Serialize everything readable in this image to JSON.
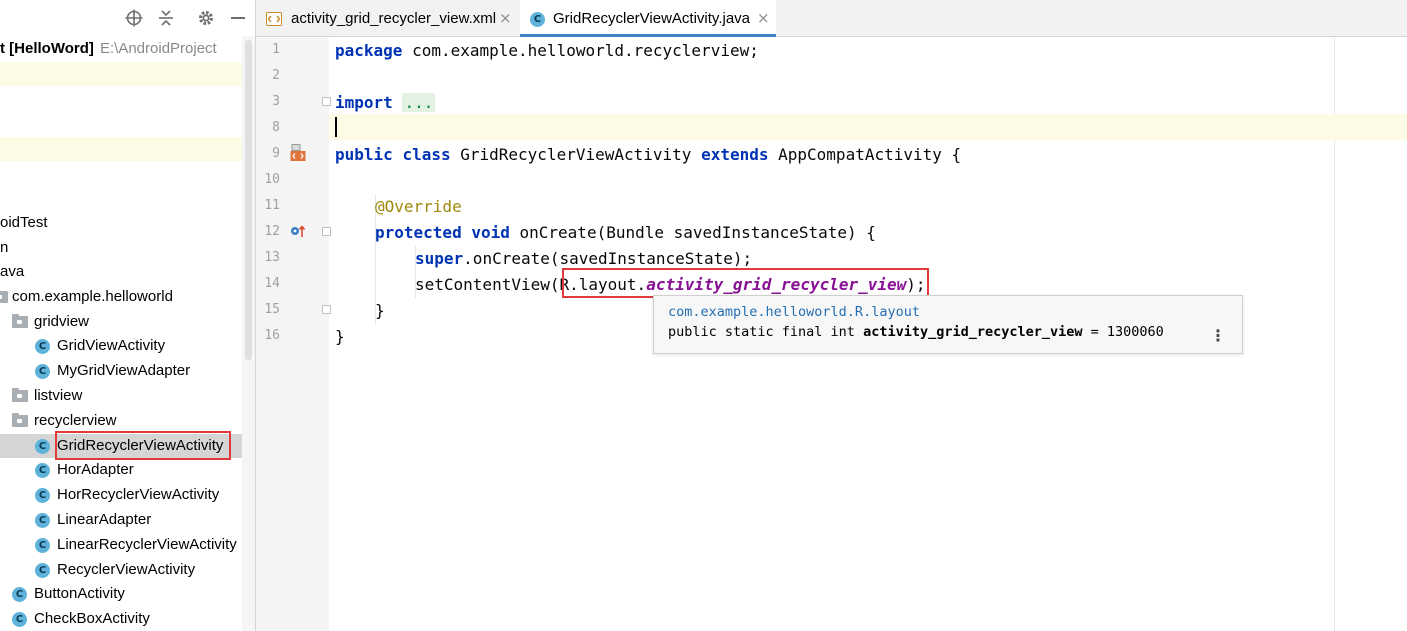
{
  "project_panel": {
    "root_label": "t [HelloWord]",
    "root_path": "E:\\AndroidProject",
    "tree": [
      {
        "label": "oidTest",
        "kind": "text"
      },
      {
        "label": "n",
        "kind": "text"
      },
      {
        "label": "ava",
        "kind": "text"
      },
      {
        "label": "com.example.helloworld",
        "kind": "package"
      },
      {
        "label": "gridview",
        "kind": "folder"
      },
      {
        "label": "GridViewActivity",
        "kind": "class"
      },
      {
        "label": "MyGridViewAdapter",
        "kind": "class"
      },
      {
        "label": "listview",
        "kind": "folder"
      },
      {
        "label": "recyclerview",
        "kind": "folder"
      },
      {
        "label": "GridRecyclerViewActivity",
        "kind": "class",
        "selected": true
      },
      {
        "label": "HorAdapter",
        "kind": "class"
      },
      {
        "label": "HorRecyclerViewActivity",
        "kind": "class"
      },
      {
        "label": "LinearAdapter",
        "kind": "class"
      },
      {
        "label": "LinearRecyclerViewActivity",
        "kind": "class"
      },
      {
        "label": "RecyclerViewActivity",
        "kind": "class"
      },
      {
        "label": "ButtonActivity",
        "kind": "class"
      },
      {
        "label": "CheckBoxActivity",
        "kind": "class"
      }
    ],
    "class_icon_letter": "C",
    "toolbar_icons": [
      "locate-icon",
      "collapse-icon",
      "gear-icon",
      "minimize-icon"
    ]
  },
  "tabs": [
    {
      "label": "activity_grid_recycler_view.xml",
      "icon": "xml-file-icon",
      "close": "×",
      "active": false
    },
    {
      "label": "GridRecyclerViewActivity.java",
      "icon": "java-class-icon",
      "close": "×",
      "active": true
    }
  ],
  "editor": {
    "line_numbers": [
      "1",
      "2",
      "3",
      "8",
      "9",
      "10",
      "11",
      "12",
      "13",
      "14",
      "15",
      "16"
    ],
    "code": {
      "l1_kw": "package",
      "l1_rest": " com.example.helloworld.recyclerview;",
      "l3_kw": "import",
      "l3_fold": "...",
      "l9_kw1": "public",
      "l9_kw2": "class",
      "l9_name": " GridRecyclerViewActivity ",
      "l9_kw3": "extends",
      "l9_rest": " AppCompatActivity {",
      "l11_ann": "@Override",
      "l12_kw1": "protected",
      "l12_kw2": "void",
      "l12_rest": " onCreate(Bundle savedInstanceState) {",
      "l13_kw": "super",
      "l13_rest": ".onCreate(savedInstanceState);",
      "l14_pre": "setContentView(R.layout.",
      "l14_field": "activity_grid_recycler_view",
      "l14_post": ");",
      "l15": "}",
      "l16": "}"
    }
  },
  "tooltip": {
    "link": "com.example.helloworld.R.layout",
    "decl_prefix": "public static final int ",
    "decl_name": "activity_grid_recycler_view",
    "decl_suffix": " = 1300060",
    "more": "⋮"
  },
  "colors": {
    "keyword": "#0033b3",
    "annotation": "#9e880d",
    "field": "#871094",
    "highlight_box": "#e03a3a",
    "active_tab_underline": "#4083c9",
    "class_icon": "#5fb2d9"
  }
}
